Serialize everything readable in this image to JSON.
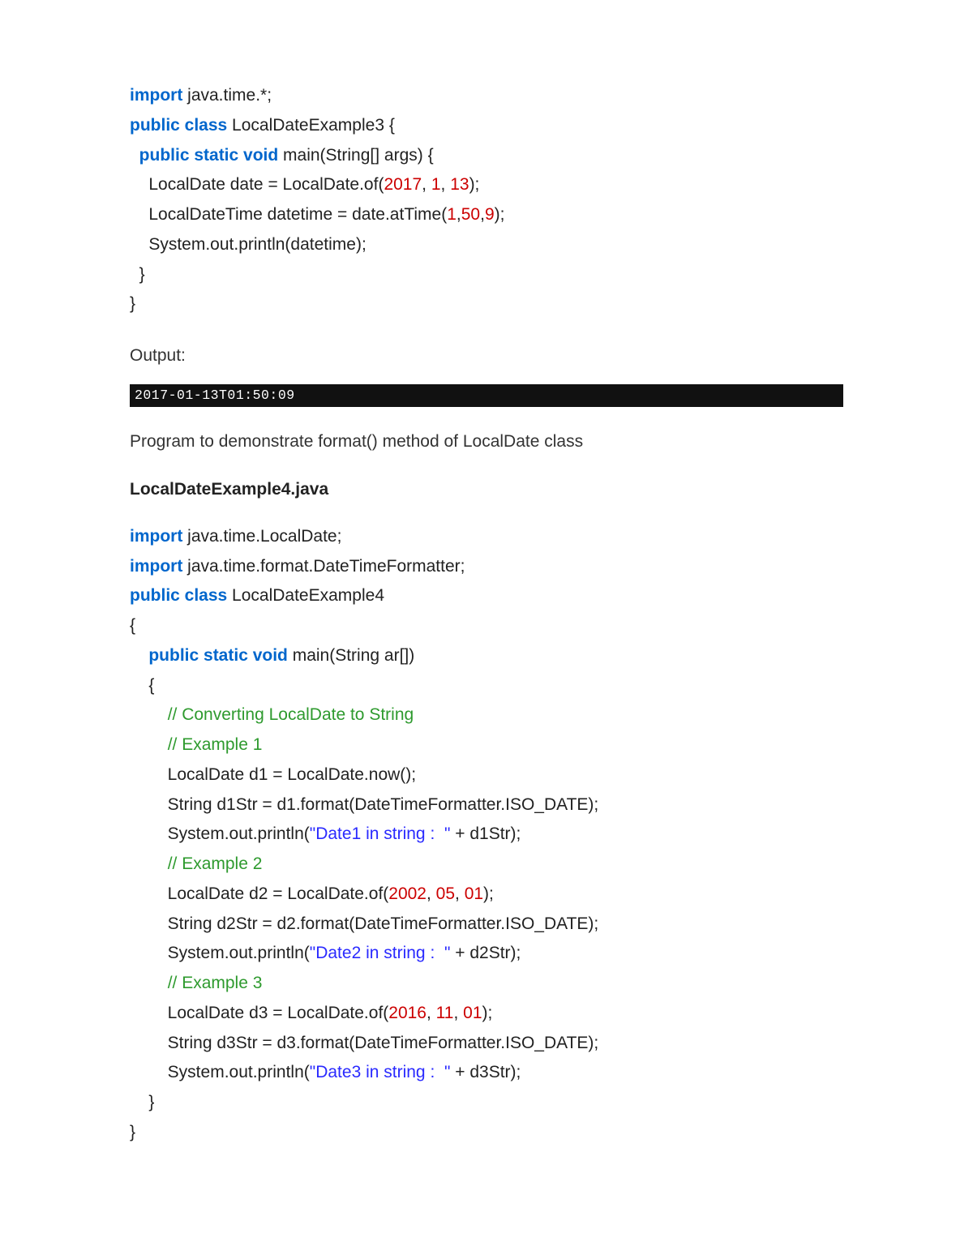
{
  "code1": {
    "l1_kw": "import",
    "l1_rest": " java.time.*;",
    "l2_kw": "public class",
    "l2_rest": " LocalDateExample3 {",
    "l3_kw": "public static void",
    "l3_rest": " main(String[] args) {",
    "l4_a": "    LocalDate date = LocalDate.of(",
    "l4_n1": "2017",
    "l4_c1": ", ",
    "l4_n2": "1",
    "l4_c2": ", ",
    "l4_n3": "13",
    "l4_b": ");",
    "l5_a": "    LocalDateTime datetime = date.atTime(",
    "l5_n1": "1",
    "l5_c1": ",",
    "l5_n2": "50",
    "l5_c2": ",",
    "l5_n3": "9",
    "l5_b": ");",
    "l6": "    System.out.println(datetime);",
    "l7": "  }",
    "l8": "}"
  },
  "output_label": "Output:",
  "output_value": "2017-01-13T01:50:09",
  "desc": "Program to demonstrate format() method of LocalDate class",
  "filename": "LocalDateExample4.java",
  "code2": {
    "l1_kw": "import",
    "l1_rest": " java.time.LocalDate;",
    "l2_kw": "import",
    "l2_rest": " java.time.format.DateTimeFormatter;",
    "l3_kw": "public class",
    "l3_rest": " LocalDateExample4",
    "l4": "{",
    "l5_kw": "public static void",
    "l5_rest": " main(String ar[])",
    "l6": "    {",
    "l7_cmt": "// Converting LocalDate to String",
    "l8_cmt": "// Example 1",
    "l9": "        LocalDate d1 = LocalDate.now();",
    "l10": "        String d1Str = d1.format(DateTimeFormatter.ISO_DATE);",
    "l11_a": "        System.out.println(",
    "l11_str": "\"Date1 in string :  \"",
    "l11_b": " + d1Str);",
    "l12_cmt": "// Example 2",
    "l13_a": "        LocalDate d2 = LocalDate.of(",
    "l13_n1": "2002",
    "l13_c1": ", ",
    "l13_n2": "05",
    "l13_c2": ", ",
    "l13_n3": "01",
    "l13_b": ");",
    "l14": "        String d2Str = d2.format(DateTimeFormatter.ISO_DATE);",
    "l15_a": "        System.out.println(",
    "l15_str": "\"Date2 in string :  \"",
    "l15_b": " + d2Str);",
    "l16_cmt": "// Example 3",
    "l17_a": "        LocalDate d3 = LocalDate.of(",
    "l17_n1": "2016",
    "l17_c1": ", ",
    "l17_n2": "11",
    "l17_c2": ", ",
    "l17_n3": "01",
    "l17_b": ");",
    "l18": "        String d3Str = d3.format(DateTimeFormatter.ISO_DATE);",
    "l19_a": "        System.out.println(",
    "l19_str": "\"Date3 in string :  \"",
    "l19_b": " + d3Str);",
    "l20": "    }",
    "l21": "}"
  }
}
